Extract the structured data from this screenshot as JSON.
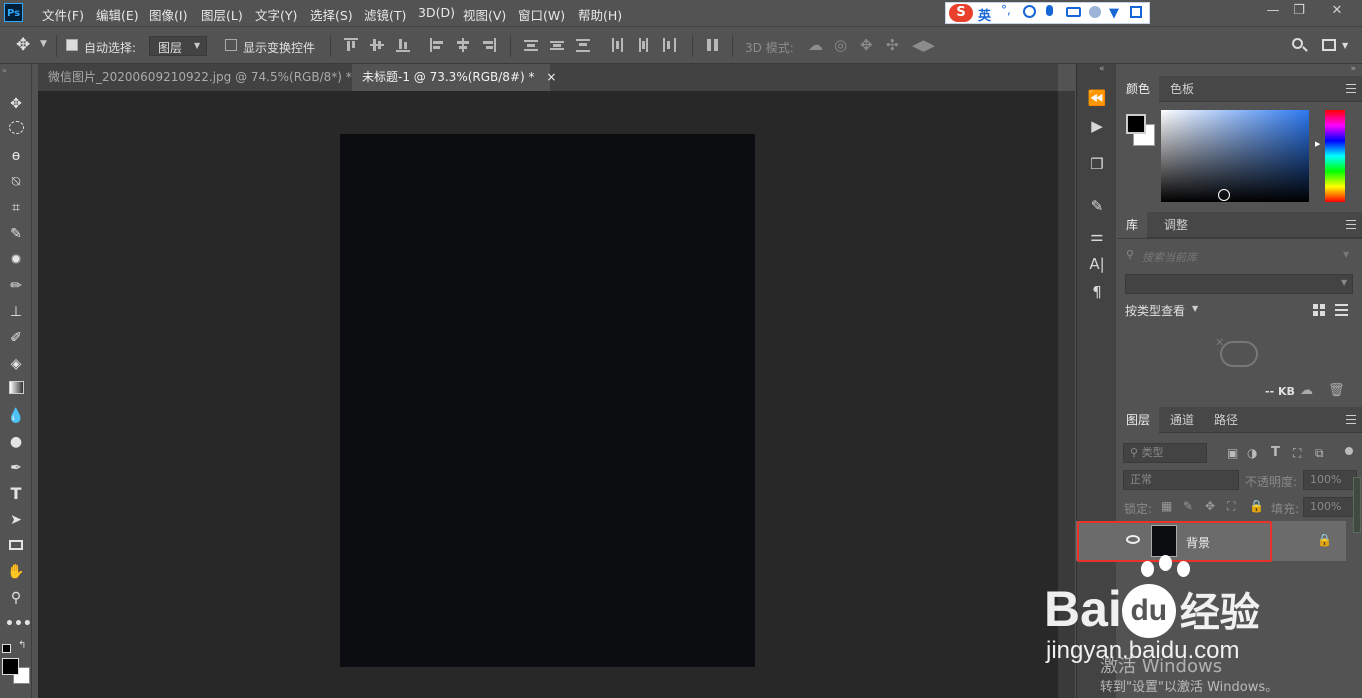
{
  "app": {
    "logo": "Ps"
  },
  "menu": [
    "文件(F)",
    "编辑(E)",
    "图像(I)",
    "图层(L)",
    "文字(Y)",
    "选择(S)",
    "滤镜(T)",
    "3D(D)",
    "视图(V)",
    "窗口(W)",
    "帮助(H)"
  ],
  "ime": {
    "label": "英"
  },
  "options": {
    "auto_select_label": "自动选择:",
    "auto_select_target": "图层",
    "show_transform_label": "显示变换控件",
    "mode_3d_label": "3D 模式:"
  },
  "tabs": [
    {
      "label": "微信图片_20200609210922.jpg @ 74.5%(RGB/8*) *",
      "close": "×"
    },
    {
      "label": "未标题-1 @ 73.3%(RGB/8#) *",
      "close": "×"
    }
  ],
  "color_panel": {
    "tabs": [
      "颜色",
      "色板"
    ]
  },
  "library_panel": {
    "tabs": [
      "库",
      "调整"
    ],
    "search_placeholder": "搜索当前库",
    "view_by": "按类型查看",
    "size": "-- KB"
  },
  "layers_panel": {
    "tabs": [
      "图层",
      "通道",
      "路径"
    ],
    "filter_kind": "类型",
    "blend_mode": "正常",
    "opacity_label": "不透明度:",
    "opacity_value": "100%",
    "lock_label": "锁定:",
    "fill_label": "填充:",
    "fill_value": "100%",
    "layers": [
      {
        "name": "背景",
        "locked": true,
        "visible": true
      }
    ]
  },
  "watermark": {
    "brand_text": "Bai",
    "brand_text2": "du",
    "brand_cn": "经验",
    "url": "jingyan.baidu.com",
    "activate_line1": "激活 Windows",
    "activate_line2": "转到\"设置\"以激活 Windows。"
  },
  "colors": {
    "foreground": "#000000",
    "background": "#ffffff",
    "document": "#0b0d11",
    "highlight": "#e8332a"
  }
}
